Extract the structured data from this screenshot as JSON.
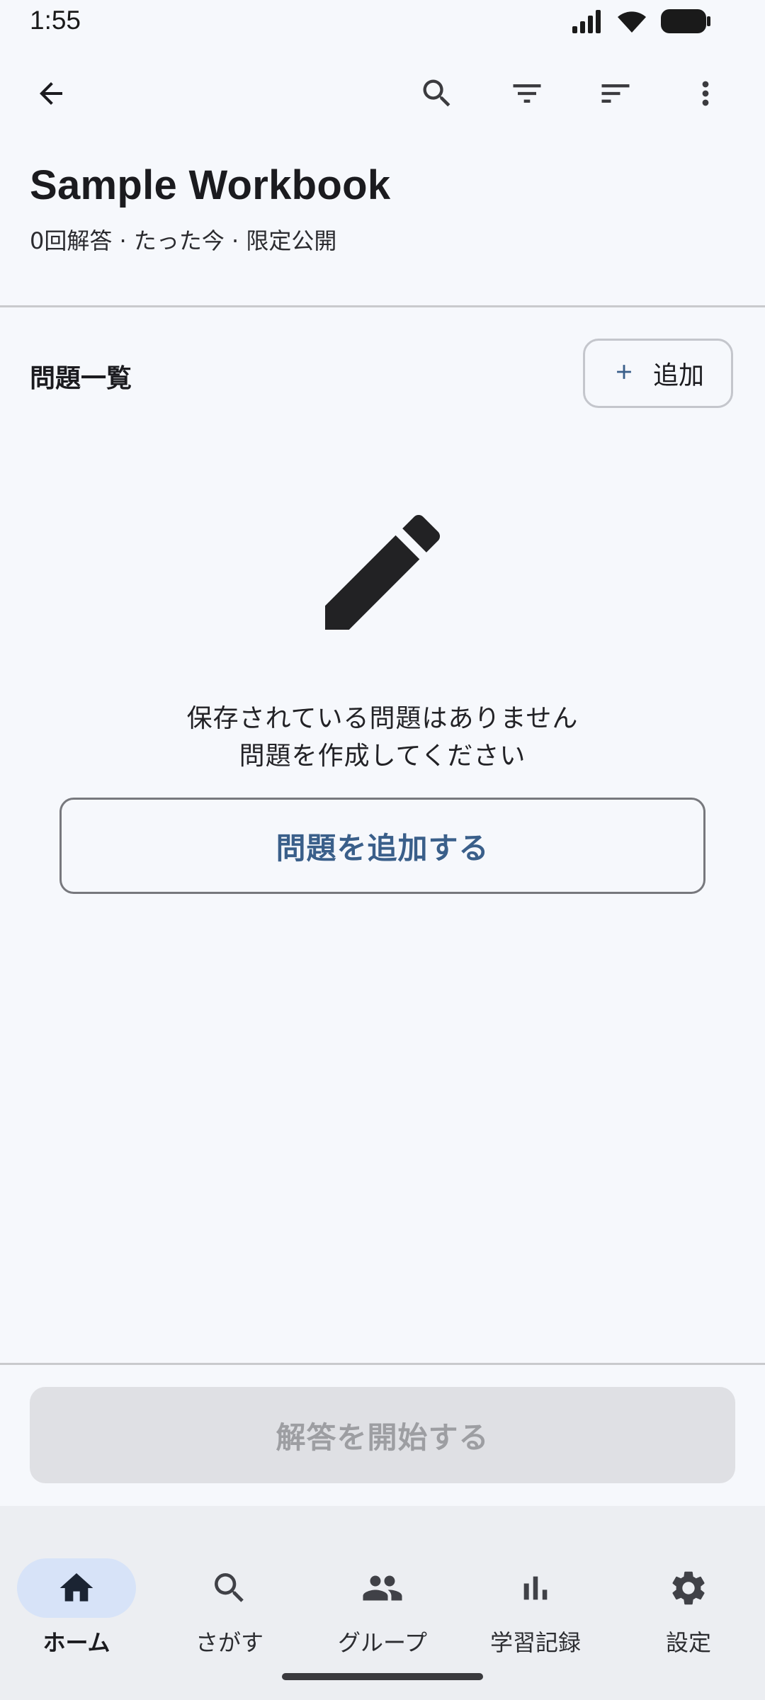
{
  "status_bar": {
    "time": "1:55"
  },
  "app_bar": {
    "icons": [
      "back-arrow-icon",
      "search-icon",
      "filter-icon",
      "sort-icon",
      "more-vert-icon"
    ]
  },
  "workbook": {
    "title": "Sample Workbook",
    "meta": "0回解答 · たった今 · 限定公開"
  },
  "questions": {
    "section_title": "問題一覧",
    "add_label": "追加",
    "empty_line1": "保存されている問題はありません",
    "empty_line2": "問題を作成してください",
    "add_question_button": "問題を追加する"
  },
  "start_button": "解答を開始する",
  "bottom_nav": {
    "items": [
      {
        "label": "ホーム",
        "icon": "home-icon",
        "selected": true
      },
      {
        "label": "さがす",
        "icon": "search-icon",
        "selected": false
      },
      {
        "label": "グループ",
        "icon": "group-icon",
        "selected": false
      },
      {
        "label": "学習記録",
        "icon": "bar-chart-icon",
        "selected": false
      },
      {
        "label": "設定",
        "icon": "settings-icon",
        "selected": false
      }
    ]
  },
  "colors": {
    "background": "#f6f8fc",
    "accent": "#3a5f8a",
    "nav_indicator": "#d7e3f8",
    "disabled_button": "#dfe0e4"
  }
}
